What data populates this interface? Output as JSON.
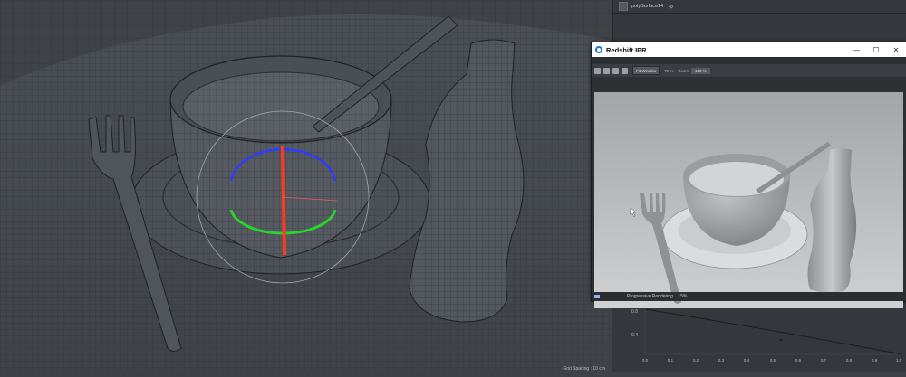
{
  "outliner": {
    "item_label": "polySurface14",
    "item_tag": "⊘"
  },
  "viewport": {
    "status_text": "Grid Spacing : 10 cm"
  },
  "ipr": {
    "title": "Redshift IPR",
    "minimize_glyph": "—",
    "maximize_glyph": "☐",
    "close_glyph": "✕",
    "fit_label": "Fit Window",
    "percent_label": "70 %",
    "zoom_label": "Zoom",
    "zoom_value": "100 %",
    "status_text": "Progressive Rendering... 15%",
    "progress_percent": 15
  },
  "graph": {
    "y_labels": [
      "0.8",
      "0.4"
    ],
    "x_labels": [
      "0.0",
      "0.1",
      "0.2",
      "0.3",
      "0.4",
      "0.5",
      "0.6",
      "0.7",
      "0.8",
      "0.9",
      "1.0"
    ]
  }
}
